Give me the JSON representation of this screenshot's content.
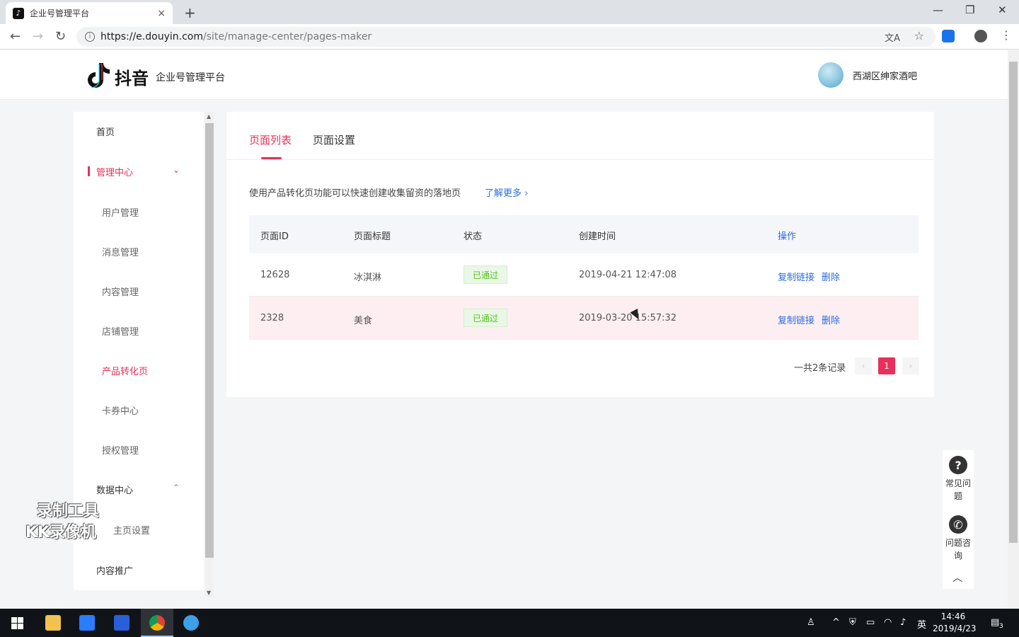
{
  "browser": {
    "tab_title": "企业号管理平台",
    "tab_close": "×",
    "new_tab": "+",
    "url_host": "https://e.douyin.com",
    "url_path": "/site/manage-center/pages-maker"
  },
  "header": {
    "logo_text": "抖音",
    "platform_name": "企业号管理平台",
    "user_name": "西湖区绅家酒吧"
  },
  "sidebar": {
    "items": [
      {
        "label": "首页"
      },
      {
        "label": "管理中心"
      },
      {
        "label": "用户管理"
      },
      {
        "label": "消息管理"
      },
      {
        "label": "内容管理"
      },
      {
        "label": "店铺管理"
      },
      {
        "label": "产品转化页"
      },
      {
        "label": "卡券中心"
      },
      {
        "label": "授权管理"
      },
      {
        "label": "数据中心"
      },
      {
        "label": "主页设置"
      },
      {
        "label": "内容推广"
      }
    ]
  },
  "watermark": {
    "line1": "录制工具",
    "line2": "KK录像机"
  },
  "main": {
    "tabs": [
      {
        "label": "页面列表"
      },
      {
        "label": "页面设置"
      }
    ],
    "hint": "使用产品转化页功能可以快速创建收集留资的落地页",
    "learn_more": "了解更多 ›",
    "table": {
      "columns": [
        "页面ID",
        "页面标题",
        "状态",
        "创建时间",
        "操作"
      ],
      "rows": [
        {
          "id": "12628",
          "title": "冰淇淋",
          "status": "已通过",
          "created": "2019-04-21 12:47:08",
          "copy": "复制链接",
          "delete": "删除"
        },
        {
          "id": "2328",
          "title": "美食",
          "status": "已通过",
          "created": "2019-03-20 15:57:32",
          "copy": "复制链接",
          "delete": "删除"
        }
      ]
    },
    "pager": {
      "total": "一共2条记录",
      "current": "1",
      "prev": "‹",
      "next": "›"
    }
  },
  "help": {
    "faq": "常见问题",
    "consult": "问题咨询"
  },
  "taskbar": {
    "time": "14:46",
    "date": "2019/4/23",
    "ime": "英",
    "notify_count": "3"
  },
  "colors": {
    "accent": "#e8305a",
    "link": "#2d6ce0",
    "success": "#52c41a"
  }
}
